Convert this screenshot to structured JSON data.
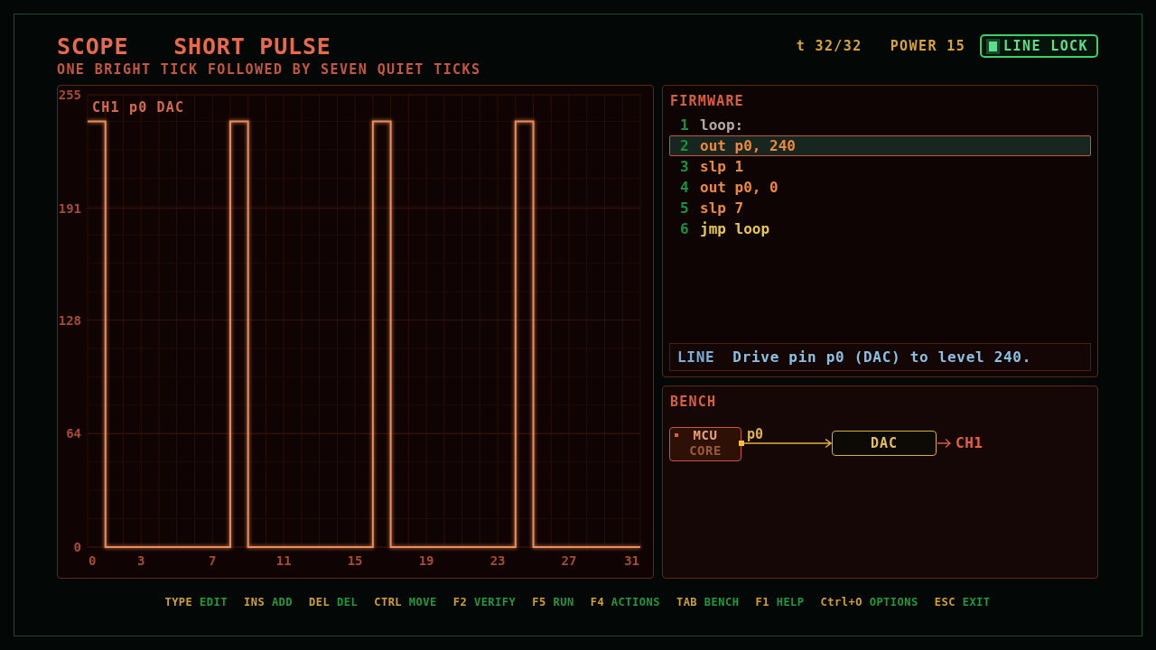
{
  "header": {
    "app": "SCOPE",
    "title": "SHORT PULSE",
    "subtitle": "ONE BRIGHT TICK FOLLOWED BY SEVEN QUIET TICKS",
    "tick": "t 32/32",
    "power": "POWER 15",
    "line_lock": {
      "label": "LINE LOCK",
      "on": true
    }
  },
  "scope": {
    "chart_data": {
      "type": "line",
      "title": "CH1 p0 DAC",
      "x": [
        0,
        1,
        1,
        8,
        8,
        9,
        9,
        16,
        16,
        17,
        17,
        24,
        24,
        25,
        25,
        31
      ],
      "series": [
        {
          "color": "#f08c5c",
          "values": [
            240,
            240,
            0,
            0,
            240,
            240,
            0,
            0,
            240,
            240,
            0,
            0,
            240,
            240,
            0,
            0
          ]
        }
      ],
      "xlim": [
        0,
        31
      ],
      "ylim": [
        0,
        255
      ],
      "xticks": [
        0,
        3,
        7,
        11,
        15,
        19,
        23,
        27,
        31
      ],
      "yticks": [
        0,
        64,
        128,
        191,
        255
      ],
      "grid": true
    }
  },
  "firmware": {
    "title": "FIRMWARE",
    "lines": [
      {
        "number": "1",
        "code": "loop:",
        "kind": "label",
        "selected": false
      },
      {
        "number": "2",
        "code": "out p0, 240",
        "kind": "op",
        "selected": true
      },
      {
        "number": "3",
        "code": "slp 1",
        "kind": "op",
        "selected": false
      },
      {
        "number": "4",
        "code": "out p0, 0",
        "kind": "op",
        "selected": false
      },
      {
        "number": "5",
        "code": "slp 7",
        "kind": "op",
        "selected": false
      },
      {
        "number": "6",
        "code": "jmp loop",
        "kind": "jump",
        "selected": false
      }
    ],
    "info": {
      "label": "LINE",
      "text": "Drive pin p0 (DAC) to level 240."
    }
  },
  "bench": {
    "title": "BENCH",
    "mcu": {
      "title": "MCU",
      "subtitle": "CORE"
    },
    "pin": "p0",
    "device": "DAC",
    "output": "CH1"
  },
  "hints": [
    {
      "key": "TYPE",
      "action": "EDIT"
    },
    {
      "key": "INS",
      "action": "ADD"
    },
    {
      "key": "DEL",
      "action": "DEL"
    },
    {
      "key": "CTRL",
      "action": "MOVE"
    },
    {
      "key": "F2",
      "action": "VERIFY"
    },
    {
      "key": "F5",
      "action": "RUN"
    },
    {
      "key": "F4",
      "action": "ACTIONS"
    },
    {
      "key": "TAB",
      "action": "BENCH"
    },
    {
      "key": "F1",
      "action": "HELP"
    },
    {
      "key": "Ctrl+O",
      "action": "OPTIONS"
    },
    {
      "key": "ESC",
      "action": "EXIT"
    }
  ]
}
